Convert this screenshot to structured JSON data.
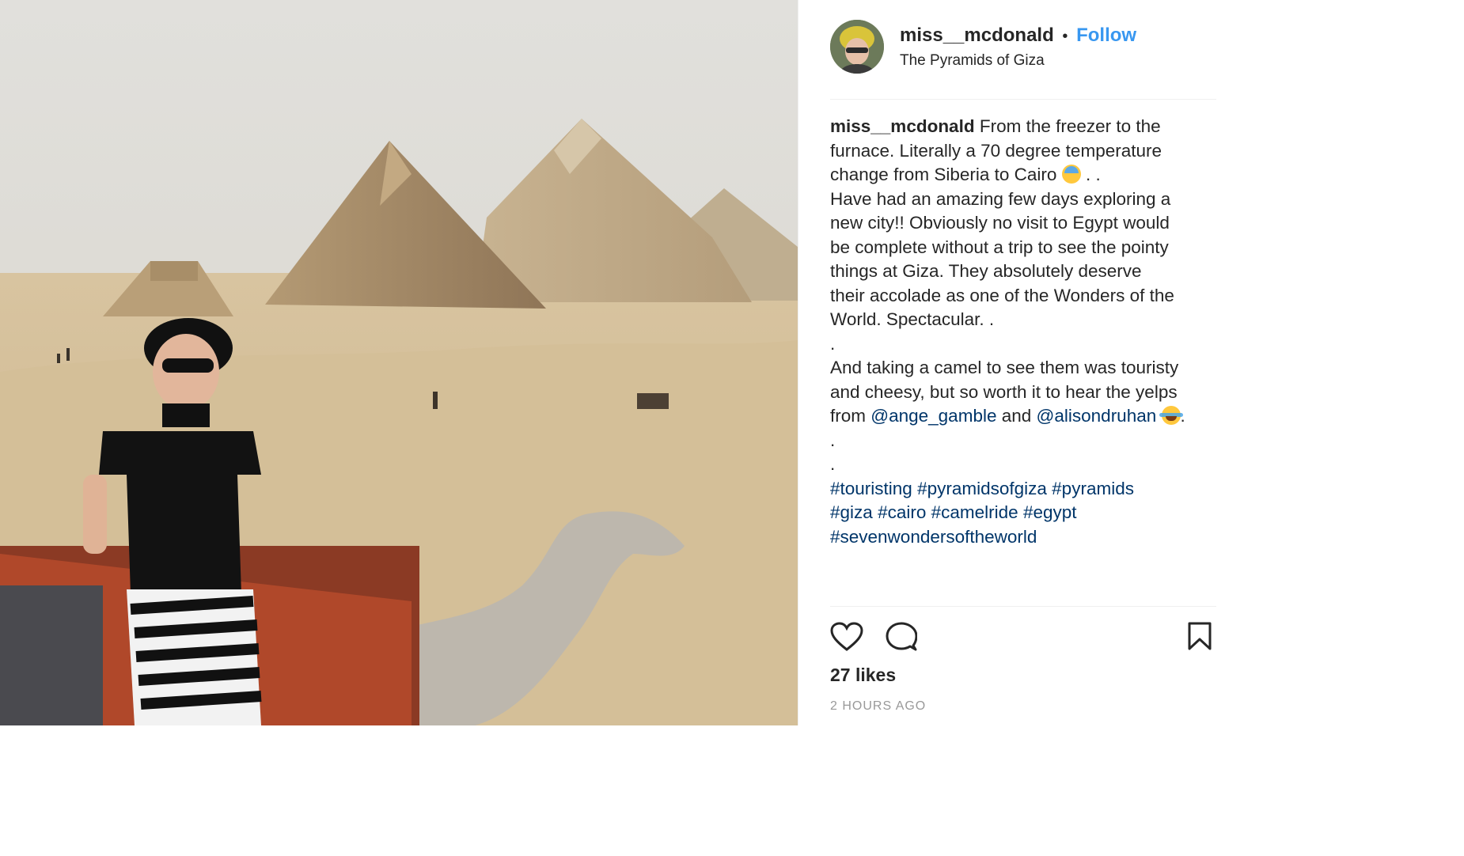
{
  "post": {
    "image_alt": "Photo",
    "header": {
      "username": "miss__mcdonald",
      "separator": "•",
      "follow_label": "Follow",
      "location": "The Pyramids of Giza"
    },
    "caption": {
      "username": "miss__mcdonald",
      "line1": "From the freezer to the",
      "line2": "furnace. Literally a 70 degree temperature",
      "line3": "change from Siberia to Cairo",
      "line3_end": ". .",
      "line4": "Have had an amazing few days exploring a",
      "line5": "new city!! Obviously no visit to Egypt would",
      "line6": "be complete without a trip to see the pointy",
      "line7": "things at Giza. They absolutely deserve",
      "line8": "their accolade as one of the Wonders of the",
      "line9": "World. Spectacular. .",
      "line10": ".",
      "line11": "And taking a camel to see them was touristy",
      "line12": "and cheesy, but so worth it to hear the yelps",
      "line13_start": "from",
      "mention1": "@ange_gamble",
      "line13_mid": "and",
      "mention2": "@alisondruhan",
      "line13_end": ".",
      "line14": ".",
      "line15": ".",
      "hashtags_line1": [
        "#touristing",
        "#pyramidsofgiza",
        "#pyramids"
      ],
      "hashtags_line2": [
        "#giza",
        "#cairo",
        "#camelride",
        "#egypt"
      ],
      "hashtags_line3": [
        "#sevenwondersoftheworld"
      ]
    },
    "actions": {
      "like_icon": "heart-outline-icon",
      "comment_icon": "comment-bubble-icon",
      "save_icon": "bookmark-outline-icon"
    },
    "likes_text": "27 likes",
    "timestamp": "2 HOURS AGO"
  },
  "colors": {
    "link": "#003569",
    "follow": "#3897f0",
    "text": "#262626",
    "muted": "#999999",
    "divider": "#efefef"
  }
}
